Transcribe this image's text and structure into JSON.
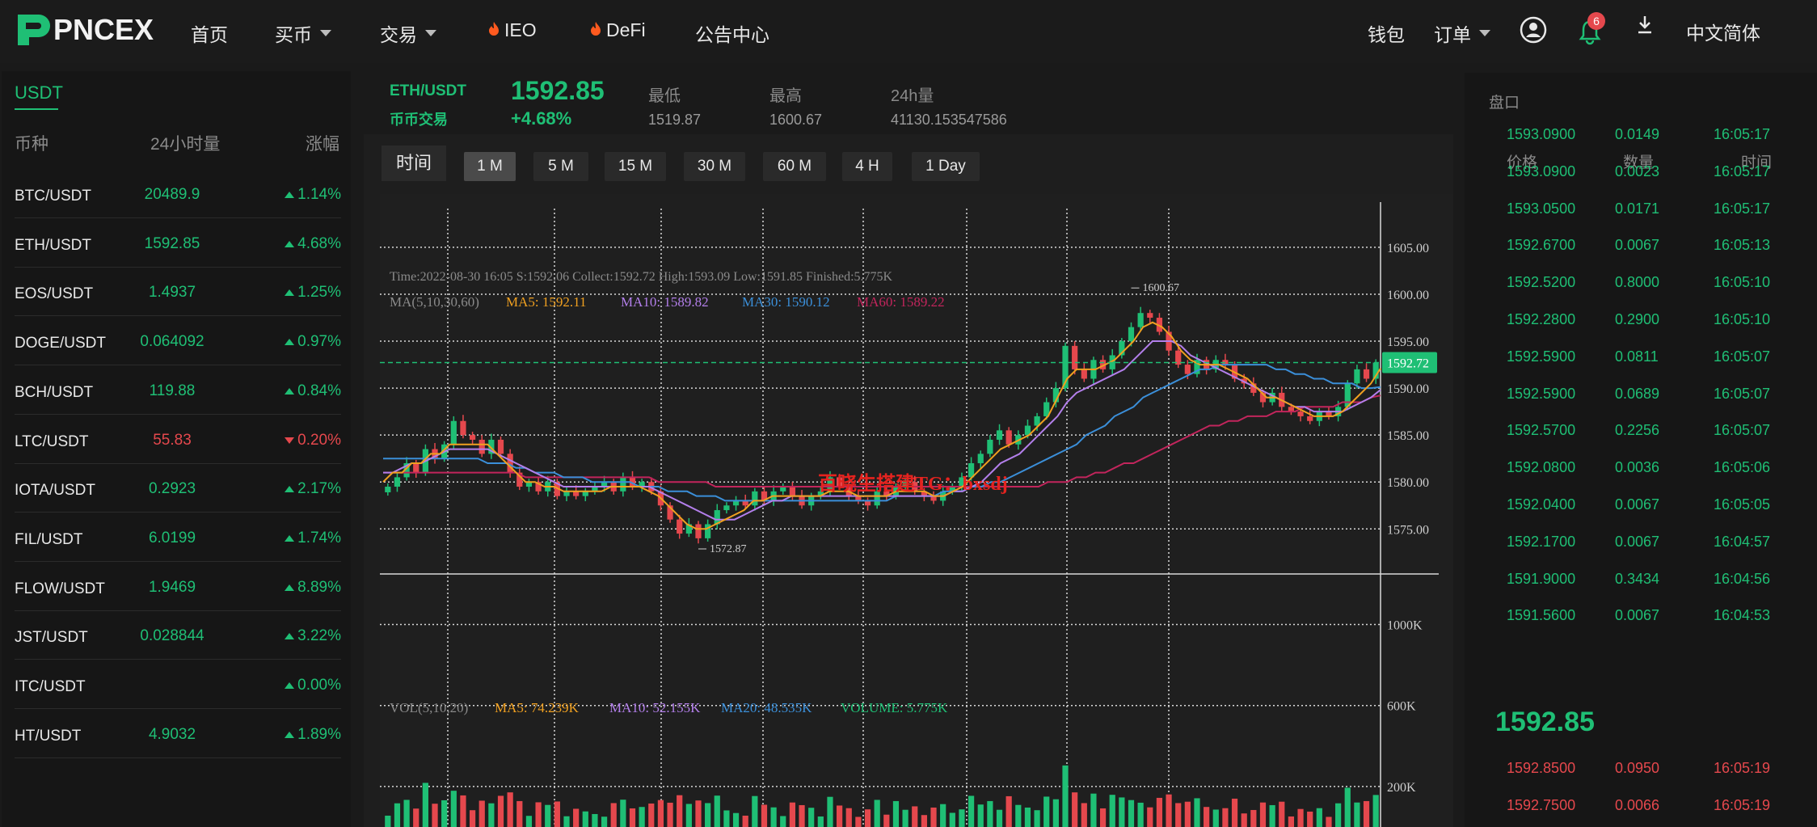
{
  "header": {
    "logo_text": "PNCEX",
    "nav": [
      {
        "label": "首页",
        "dropdown": false,
        "flame": false
      },
      {
        "label": "买币",
        "dropdown": true,
        "flame": false
      },
      {
        "label": "交易",
        "dropdown": true,
        "flame": false
      },
      {
        "label": "IEO",
        "dropdown": false,
        "flame": true
      },
      {
        "label": "DeFi",
        "dropdown": false,
        "flame": true
      },
      {
        "label": "公告中心",
        "dropdown": false,
        "flame": false
      }
    ],
    "wallet_label": "钱包",
    "orders_label": "订单",
    "notification_count": "6",
    "language": "中文简体",
    "icons": [
      "user-circle-icon",
      "bell-icon",
      "download-icon"
    ]
  },
  "market_list": {
    "tab": "USDT",
    "headers": {
      "coin": "币种",
      "volume": "24小时量",
      "change": "涨幅"
    },
    "rows": [
      {
        "pair": "BTC/USDT",
        "price": "20489.9",
        "change": "1.14%",
        "dir": "up"
      },
      {
        "pair": "ETH/USDT",
        "price": "1592.85",
        "change": "4.68%",
        "dir": "up"
      },
      {
        "pair": "EOS/USDT",
        "price": "1.4937",
        "change": "1.25%",
        "dir": "up"
      },
      {
        "pair": "DOGE/USDT",
        "price": "0.064092",
        "change": "0.97%",
        "dir": "up"
      },
      {
        "pair": "BCH/USDT",
        "price": "119.88",
        "change": "0.84%",
        "dir": "up"
      },
      {
        "pair": "LTC/USDT",
        "price": "55.83",
        "change": "0.20%",
        "dir": "down"
      },
      {
        "pair": "IOTA/USDT",
        "price": "0.2923",
        "change": "2.17%",
        "dir": "up"
      },
      {
        "pair": "FIL/USDT",
        "price": "6.0199",
        "change": "1.74%",
        "dir": "up"
      },
      {
        "pair": "FLOW/USDT",
        "price": "1.9469",
        "change": "8.89%",
        "dir": "up"
      },
      {
        "pair": "JST/USDT",
        "price": "0.028844",
        "change": "3.22%",
        "dir": "up"
      },
      {
        "pair": "ITC/USDT",
        "price": "",
        "change": "0.00%",
        "dir": "up"
      },
      {
        "pair": "HT/USDT",
        "price": "4.9032",
        "change": "1.89%",
        "dir": "up"
      }
    ]
  },
  "ticker": {
    "pair": "ETH/USDT",
    "subtitle": "币币交易",
    "price": "1592.85",
    "change": "+4.68%",
    "low_label": "最低",
    "low": "1519.87",
    "high_label": "最高",
    "high": "1600.67",
    "vol_label": "24h量",
    "vol": "41130.153547586"
  },
  "timeframes": {
    "time_label": "时间",
    "options": [
      "1 M",
      "5 M",
      "15 M",
      "30 M",
      "60 M",
      "4 H",
      "1 Day"
    ],
    "active": "1 M"
  },
  "chart_info": {
    "ohlc_line": "Time:2022-08-30 16:05     S:1592.06     Collect:1592.72     High:1593.09     Low:1591.85     Finished:5.775K",
    "ma_title": "MA(5,10,30,60)",
    "ma5": "MA5: 1592.11",
    "ma10": "MA10: 1589.82",
    "ma30": "MA30: 1590.12",
    "ma60": "MA60: 1589.22",
    "vol_title": "VOL(5,10,20)",
    "vma5": "MA5: 74.239K",
    "vma10": "MA10: 52.155K",
    "vma20": "MA20: 48.535K",
    "volume": "VOLUME: 5.775K",
    "watermark": "百晓生搭建TG：bxsdj",
    "last_price_tag": "1592.72",
    "high_marker": "1600.67",
    "low_marker": "1572.87"
  },
  "chart_data": {
    "type": "candlestick",
    "price_ticks": [
      "1605.00",
      "1600.00",
      "1595.00",
      "1590.00",
      "1585.00",
      "1580.00",
      "1575.00"
    ],
    "price_tick_values": [
      1605,
      1600,
      1595,
      1590,
      1585,
      1580,
      1575
    ],
    "volume_ticks": [
      "1000K",
      "600K",
      "200K"
    ],
    "volume_tick_values": [
      1000,
      600,
      200
    ],
    "ylim": [
      1570.2,
      1606.2
    ],
    "vol_max_k": 1090,
    "last_price": 1592.72,
    "high": 1600.67,
    "low": 1572.87,
    "close_path": [
      1579.5,
      1580.5,
      1582.0,
      1581.0,
      1583.5,
      1582.5,
      1584.0,
      1586.5,
      1585.0,
      1584.5,
      1583.0,
      1584.5,
      1583.0,
      1581.0,
      1579.5,
      1580.0,
      1579.0,
      1580.0,
      1578.5,
      1579.0,
      1578.5,
      1579.0,
      1579.5,
      1580.0,
      1579.0,
      1580.5,
      1579.5,
      1580.0,
      1579.0,
      1577.5,
      1576.0,
      1574.5,
      1575.5,
      1574.0,
      1575.5,
      1577.0,
      1577.5,
      1578.0,
      1577.5,
      1579.0,
      1578.0,
      1579.0,
      1579.5,
      1578.5,
      1577.5,
      1578.5,
      1579.0,
      1580.5,
      1579.5,
      1578.5,
      1578.0,
      1577.5,
      1579.0,
      1578.5,
      1579.5,
      1580.0,
      1579.0,
      1578.5,
      1578.0,
      1579.0,
      1579.5,
      1580.5,
      1582.0,
      1583.0,
      1584.5,
      1585.5,
      1584.0,
      1585.0,
      1586.0,
      1587.0,
      1588.5,
      1590.0,
      1594.5,
      1592.0,
      1591.0,
      1593.0,
      1592.0,
      1593.5,
      1595.0,
      1596.5,
      1598.0,
      1597.5,
      1596.0,
      1594.0,
      1592.5,
      1591.5,
      1593.0,
      1592.0,
      1593.0,
      1592.5,
      1591.0,
      1590.5,
      1589.5,
      1588.5,
      1589.5,
      1588.0,
      1587.5,
      1587.0,
      1586.5,
      1587.5,
      1587.0,
      1588.0,
      1590.5,
      1592.0,
      1591.0,
      1592.72
    ],
    "ma5": [
      1580,
      1581,
      1581,
      1582,
      1582,
      1583,
      1583,
      1584,
      1584,
      1584,
      1584,
      1584,
      1583,
      1582,
      1581,
      1580,
      1580,
      1579.5,
      1579.5,
      1579,
      1579,
      1579,
      1579,
      1579,
      1579.5,
      1579.5,
      1579.5,
      1579.5,
      1579,
      1578.5,
      1577.5,
      1576.5,
      1575.5,
      1575,
      1575,
      1575.5,
      1576,
      1576.5,
      1577,
      1578,
      1578,
      1578.5,
      1578.5,
      1578.5,
      1578.5,
      1578.5,
      1578.5,
      1579,
      1579,
      1579,
      1578.5,
      1578.5,
      1578.5,
      1578.5,
      1579,
      1579,
      1579,
      1579,
      1578.5,
      1578.5,
      1579,
      1579.5,
      1580.5,
      1581.5,
      1582.5,
      1583.5,
      1584,
      1584.5,
      1585,
      1586,
      1587,
      1589,
      1591,
      1592,
      1592,
      1592,
      1592.5,
      1593,
      1594,
      1595,
      1596.5,
      1597,
      1596.5,
      1595.5,
      1594,
      1593,
      1592.5,
      1592.5,
      1592.5,
      1592,
      1591.5,
      1591,
      1590,
      1589,
      1589,
      1588.5,
      1588,
      1587.5,
      1587,
      1587,
      1587,
      1587.5,
      1588.5,
      1589.5,
      1590.5,
      1592.11
    ],
    "ma10": [
      1581,
      1581,
      1581.5,
      1582,
      1582,
      1582.5,
      1583,
      1583.5,
      1583.5,
      1583.5,
      1583.5,
      1583.5,
      1583,
      1582.5,
      1582,
      1581.5,
      1581,
      1580.5,
      1580,
      1579.5,
      1579.5,
      1579.5,
      1579.5,
      1579.5,
      1579.5,
      1579.5,
      1579.5,
      1579.5,
      1579.5,
      1579,
      1578.5,
      1578,
      1577.5,
      1577,
      1576.5,
      1576,
      1576,
      1576,
      1576.5,
      1577,
      1577.5,
      1578,
      1578,
      1578.5,
      1578.5,
      1578.5,
      1578.5,
      1578.5,
      1578.5,
      1578.5,
      1578.5,
      1578.5,
      1578.5,
      1578.5,
      1578.5,
      1578.5,
      1578.5,
      1578.5,
      1578.5,
      1578.5,
      1579,
      1579,
      1579.5,
      1580,
      1581,
      1582,
      1582.5,
      1583,
      1584,
      1585,
      1586,
      1587,
      1588.5,
      1589.5,
      1590,
      1590.5,
      1591,
      1591.5,
      1592,
      1593,
      1594,
      1595,
      1595,
      1595,
      1594.5,
      1593.5,
      1593,
      1592.5,
      1592,
      1591.5,
      1591,
      1590.5,
      1590,
      1589.5,
      1589,
      1588.5,
      1588,
      1588,
      1587.5,
      1587.5,
      1587.5,
      1587.5,
      1588,
      1588.5,
      1589,
      1589.82
    ],
    "ma30": [
      1582.5,
      1582.5,
      1582.5,
      1582.5,
      1582.5,
      1582.5,
      1582.5,
      1582.5,
      1582.5,
      1582.5,
      1582.5,
      1582,
      1582,
      1582,
      1581.5,
      1581.5,
      1581,
      1581,
      1581,
      1580.5,
      1580.5,
      1580.5,
      1580,
      1580,
      1580,
      1580,
      1580,
      1579.5,
      1579.5,
      1579.5,
      1579,
      1579,
      1579,
      1578.5,
      1578.5,
      1578.5,
      1578,
      1578,
      1578,
      1578,
      1578,
      1578,
      1578,
      1578,
      1578,
      1578,
      1578,
      1578,
      1578,
      1578,
      1578,
      1578,
      1578,
      1578,
      1578.5,
      1578.5,
      1578.5,
      1578.5,
      1578.5,
      1579,
      1579,
      1579,
      1579.5,
      1579.5,
      1580,
      1580,
      1580.5,
      1581,
      1581.5,
      1582,
      1582.5,
      1583,
      1583.5,
      1584,
      1585,
      1585.5,
      1586,
      1587,
      1587.5,
      1588,
      1589,
      1589.5,
      1590,
      1590.5,
      1591,
      1591.5,
      1592,
      1592,
      1592.5,
      1592.5,
      1592.5,
      1592.5,
      1592.5,
      1592.5,
      1592,
      1592,
      1591.5,
      1591.5,
      1591,
      1591,
      1590.5,
      1590.5,
      1590.5,
      1590,
      1590,
      1590.12
    ],
    "ma60": [
      1581,
      1581,
      1581,
      1581,
      1581,
      1581,
      1581,
      1581,
      1581,
      1581,
      1581,
      1581,
      1581,
      1581,
      1581,
      1580.5,
      1580.5,
      1580.5,
      1580.5,
      1580.5,
      1580.5,
      1580.5,
      1580.5,
      1580.5,
      1580.5,
      1580.5,
      1580.5,
      1580.5,
      1580.5,
      1580,
      1580,
      1580,
      1580,
      1580,
      1580,
      1579.5,
      1579.5,
      1579.5,
      1579.5,
      1579.5,
      1579.5,
      1579.5,
      1579.5,
      1579.5,
      1579.5,
      1579.5,
      1579.5,
      1579.5,
      1579.5,
      1579.5,
      1579.5,
      1579.5,
      1579.5,
      1579.5,
      1579.5,
      1579.5,
      1579.5,
      1579.5,
      1579.5,
      1579.5,
      1579.5,
      1579.5,
      1579.5,
      1579.5,
      1579.5,
      1579.5,
      1579.5,
      1579.5,
      1579.5,
      1579.5,
      1580,
      1580,
      1580,
      1580.5,
      1580.5,
      1581,
      1581,
      1581.5,
      1582,
      1582,
      1582.5,
      1583,
      1583.5,
      1584,
      1584.5,
      1585,
      1585.5,
      1586,
      1586,
      1586.5,
      1586.5,
      1587,
      1587,
      1587,
      1587.5,
      1587.5,
      1587.5,
      1588,
      1588,
      1588,
      1588,
      1588.5,
      1588.5,
      1588.5,
      1589,
      1589.22
    ],
    "colors": {
      "up": "#1fbf75",
      "down": "#e5484d",
      "ma5": "#f0a020",
      "ma10": "#b37feb",
      "ma30": "#3b8fd9",
      "ma60": "#c2255c"
    }
  },
  "orderbook": {
    "title": "盘口",
    "headers": {
      "price": "价格",
      "amount": "数量",
      "time": "时间"
    },
    "buys": [
      {
        "price": "1593.0900",
        "amount": "0.0149",
        "time": "16:05:17"
      },
      {
        "price": "1593.0900",
        "amount": "0.0023",
        "time": "16:05:17"
      },
      {
        "price": "1593.0500",
        "amount": "0.0171",
        "time": "16:05:17"
      },
      {
        "price": "1592.6700",
        "amount": "0.0067",
        "time": "16:05:13"
      },
      {
        "price": "1592.5200",
        "amount": "0.8000",
        "time": "16:05:10"
      },
      {
        "price": "1592.2800",
        "amount": "0.2900",
        "time": "16:05:10"
      },
      {
        "price": "1592.5900",
        "amount": "0.0811",
        "time": "16:05:07"
      },
      {
        "price": "1592.5900",
        "amount": "0.0689",
        "time": "16:05:07"
      },
      {
        "price": "1592.5700",
        "amount": "0.2256",
        "time": "16:05:07"
      },
      {
        "price": "1592.0800",
        "amount": "0.0036",
        "time": "16:05:06"
      },
      {
        "price": "1592.0400",
        "amount": "0.0067",
        "time": "16:05:05"
      },
      {
        "price": "1592.1700",
        "amount": "0.0067",
        "time": "16:04:57"
      },
      {
        "price": "1591.9000",
        "amount": "0.3434",
        "time": "16:04:56"
      },
      {
        "price": "1591.5600",
        "amount": "0.0067",
        "time": "16:04:53"
      }
    ],
    "last_price": "1592.85",
    "sells": [
      {
        "price": "1592.8500",
        "amount": "0.0950",
        "time": "16:05:19"
      },
      {
        "price": "1592.7500",
        "amount": "0.0066",
        "time": "16:05:19"
      }
    ]
  }
}
